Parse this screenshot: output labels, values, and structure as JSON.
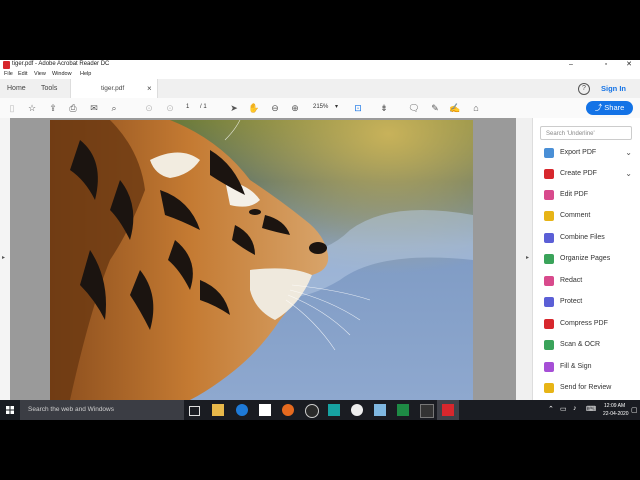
{
  "window": {
    "title": "tiger.pdf - Adobe Acrobat Reader DC",
    "controls": {
      "minimize": "–",
      "maximize": "▫",
      "close": "✕"
    }
  },
  "menu": [
    "File",
    "Edit",
    "View",
    "Window",
    "Help"
  ],
  "tabs": {
    "home": "Home",
    "tools": "Tools",
    "document": "tiger.pdf",
    "close": "×"
  },
  "header_right": {
    "help": "?",
    "sign_in": "Sign In",
    "share": "Share"
  },
  "toolbar": {
    "page_current": "1",
    "page_total": "/ 1",
    "zoom": "215%",
    "icons": [
      "create-icon",
      "star-icon",
      "upload-icon",
      "print-icon",
      "email-icon",
      "search-icon",
      "prev-page-icon",
      "next-page-icon",
      "select-icon",
      "hand-icon",
      "zoom-out-icon",
      "zoom-in-icon",
      "zoom-dropdown-icon",
      "fit-icon",
      "scroll-icon",
      "comment-icon",
      "pen-icon",
      "sign-icon",
      "stamp-icon"
    ]
  },
  "right_panel": {
    "search_placeholder": "Search 'Underline'",
    "items": [
      {
        "label": "Export PDF",
        "icon": "export-pdf-icon",
        "color": "#4a8fd6",
        "expand": "⌄"
      },
      {
        "label": "Create PDF",
        "icon": "create-pdf-icon",
        "color": "#d7272d",
        "expand": "⌄"
      },
      {
        "label": "Edit PDF",
        "icon": "edit-pdf-icon",
        "color": "#d84a8c"
      },
      {
        "label": "Comment",
        "icon": "comment-icon",
        "color": "#e7b416"
      },
      {
        "label": "Combine Files",
        "icon": "combine-files-icon",
        "color": "#5b5fd6"
      },
      {
        "label": "Organize Pages",
        "icon": "organize-pages-icon",
        "color": "#3aa35a"
      },
      {
        "label": "Redact",
        "icon": "redact-icon",
        "color": "#d84a8c"
      },
      {
        "label": "Protect",
        "icon": "protect-icon",
        "color": "#5b5fd6"
      },
      {
        "label": "Compress PDF",
        "icon": "compress-pdf-icon",
        "color": "#d7272d"
      },
      {
        "label": "Scan & OCR",
        "icon": "scan-ocr-icon",
        "color": "#3aa35a"
      },
      {
        "label": "Fill & Sign",
        "icon": "fill-sign-icon",
        "color": "#a64fd6"
      },
      {
        "label": "Send for Review",
        "icon": "send-review-icon",
        "color": "#e7b416"
      }
    ]
  },
  "taskbar": {
    "search_text": "Search the web and Windows",
    "time": "12:09 AM",
    "date": "22-04-2020",
    "icons": [
      "task-view-icon",
      "file-explorer-icon",
      "edge-icon",
      "store-icon",
      "firefox-icon",
      "chrome-icon",
      "app-icon",
      "camtasia-icon",
      "app2-icon",
      "excel-icon",
      "terminal-icon",
      "acrobat-icon"
    ]
  },
  "colors": {
    "accent": "#1473e6",
    "acrobat_red": "#d7272d",
    "taskbar": "#1a1c22"
  }
}
